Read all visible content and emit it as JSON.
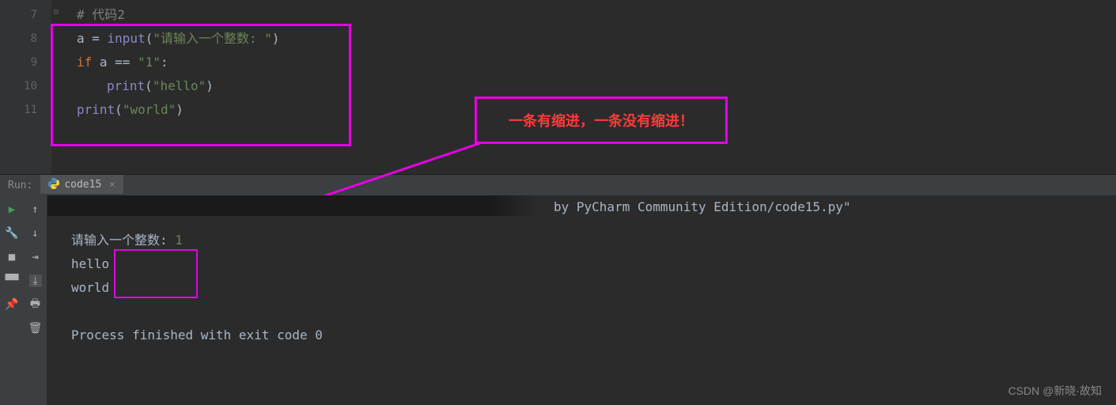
{
  "gutter": [
    "7",
    "8",
    "9",
    "10",
    "11"
  ],
  "code": {
    "l7_comment": "# 代码2",
    "l8_var": "a ",
    "l8_op": "= ",
    "l8_fn": "input",
    "l8_paren_o": "(",
    "l8_str": "\"请输入一个整数: \"",
    "l8_paren_c": ")",
    "l9_kw": "if ",
    "l9_var": "a ",
    "l9_op": "== ",
    "l9_str": "\"1\"",
    "l9_colon": ":",
    "l10_fn": "print",
    "l10_paren_o": "(",
    "l10_str": "\"hello\"",
    "l10_paren_c": ")",
    "l11_fn": "print",
    "l11_paren_o": "(",
    "l11_str": "\"world\"",
    "l11_paren_c": ")"
  },
  "annotation": "一条有缩进，一条没有缩进！",
  "run": {
    "label": "Run:",
    "tab": "code15",
    "close": "×"
  },
  "console": {
    "path": " by PyCharm Community Edition/code15.py\"",
    "prompt": "请输入一个整数: ",
    "input": "1",
    "out1": "hello",
    "out2": "world",
    "exit": "Process finished with exit code 0"
  },
  "watermark": "CSDN @新晓·故知"
}
